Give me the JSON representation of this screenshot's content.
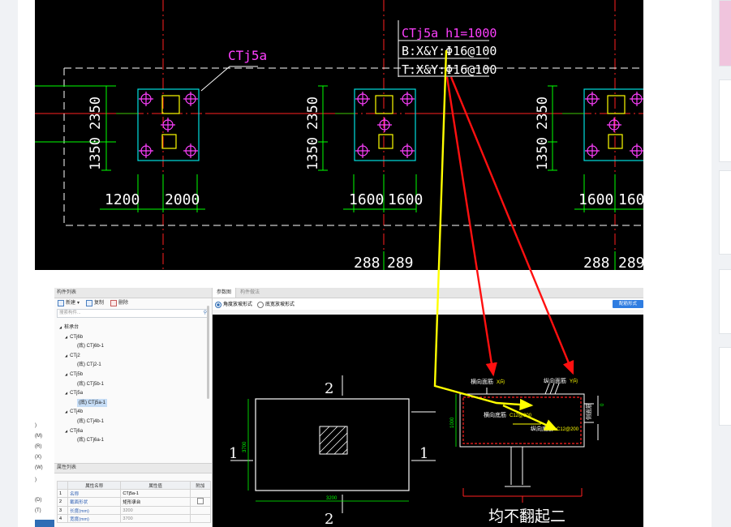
{
  "top_drawing": {
    "callout_left": "CTj5a",
    "callout_title": "CTj5a  h1=1000",
    "callout_line_b": "B:X&Y:Φ16@100",
    "callout_line_t": "T:X&Y:Φ16@100",
    "dims_vertical_top": [
      "2350",
      "2350",
      "2350"
    ],
    "dims_vertical_bottom": [
      "1350",
      "1350",
      "1350"
    ],
    "dims_horizontal": [
      "1200",
      "2000",
      "1600",
      "1600",
      "1600",
      "160"
    ],
    "dims_bottom": [
      "288",
      "289",
      "288",
      "289"
    ]
  },
  "app": {
    "left_strip_labels": [
      ")",
      "(M)",
      "(R)",
      "(X)",
      "(W)",
      ")",
      "(D)",
      "(T)"
    ],
    "component_panel": {
      "title": "构件列表",
      "new_label": "新建",
      "copy_label": "复制",
      "delete_label": "删除",
      "search_placeholder": "搜索构件...",
      "tree": [
        {
          "label": "桩承台",
          "level": 0,
          "arrow": "◢"
        },
        {
          "label": "CTj6b",
          "level": 1,
          "arrow": "◢"
        },
        {
          "label": "(底) CTj6b-1",
          "level": 2,
          "arrow": ""
        },
        {
          "label": "CTj2",
          "level": 1,
          "arrow": "◢"
        },
        {
          "label": "(底) CTj2-1",
          "level": 2,
          "arrow": ""
        },
        {
          "label": "CTj5b",
          "level": 1,
          "arrow": "◢"
        },
        {
          "label": "(底) CTj5b-1",
          "level": 2,
          "arrow": ""
        },
        {
          "label": "CTj5a",
          "level": 1,
          "arrow": "◢"
        },
        {
          "label": "(底) CTj5a-1",
          "level": 2,
          "arrow": "",
          "selected": true
        },
        {
          "label": "CTj4b",
          "level": 1,
          "arrow": "◢"
        },
        {
          "label": "(底) CTj4b-1",
          "level": 2,
          "arrow": ""
        },
        {
          "label": "CTj6a",
          "level": 1,
          "arrow": "◢"
        },
        {
          "label": "(底) CTj6a-1",
          "level": 2,
          "arrow": ""
        }
      ]
    },
    "property_panel": {
      "title": "属性列表",
      "headers": [
        "",
        "属性名称",
        "属性值",
        "附加"
      ],
      "rows": [
        {
          "num": "1",
          "name": "名称",
          "value": "CTj5a-1",
          "attach": false,
          "value_grey": false,
          "has_checkbox": false
        },
        {
          "num": "2",
          "name": "截面形状",
          "value": "矩形承台",
          "attach": false,
          "value_grey": false,
          "has_checkbox": true
        },
        {
          "num": "3",
          "name": "长度(mm)",
          "value": "3200",
          "attach": false,
          "value_grey": true,
          "has_checkbox": false
        },
        {
          "num": "4",
          "name": "宽度(mm)",
          "value": "3700",
          "attach": false,
          "value_grey": true,
          "has_checkbox": false
        }
      ]
    },
    "right_panel": {
      "tabs": [
        "参数图",
        "构件做法"
      ],
      "radio_options": [
        "角度放坡形式",
        "底宽放坡形式"
      ],
      "radio_selected": 0,
      "config_button": "配筋形式"
    },
    "param_drawing": {
      "section_num_top": "2",
      "section_num_bottom": "2",
      "section_num_left": "1",
      "section_num_right": "1",
      "dim_width": "3200",
      "dim_height": "3700",
      "label_h_top": "横向面筋",
      "label_v_top": "纵向面筋",
      "label_h_bottom": "横向底筋",
      "label_v_bottom": "纵向底筋",
      "label_side": "侧面筋",
      "tag_h_top": "X向",
      "tag_v_top": "Y向",
      "tag_h_bottom": "C12@200",
      "tag_v_bottom": "C12@200",
      "dim_depth": "1000",
      "bottom_caption": "均不翻起二",
      "dim_small": "0"
    }
  },
  "colors": {
    "cad_bg": "#000000",
    "dashed_outline": "#ffffff",
    "axis_red": "#ff2020",
    "dim_green": "#00ff00",
    "pile_magenta": "#ff40ff",
    "cap_cyan": "#00e0e0",
    "column_yellow": "#ffff00",
    "arrow_yellow": "#ffff00",
    "arrow_red": "#ff1010",
    "accent_blue": "#2f7de1"
  }
}
